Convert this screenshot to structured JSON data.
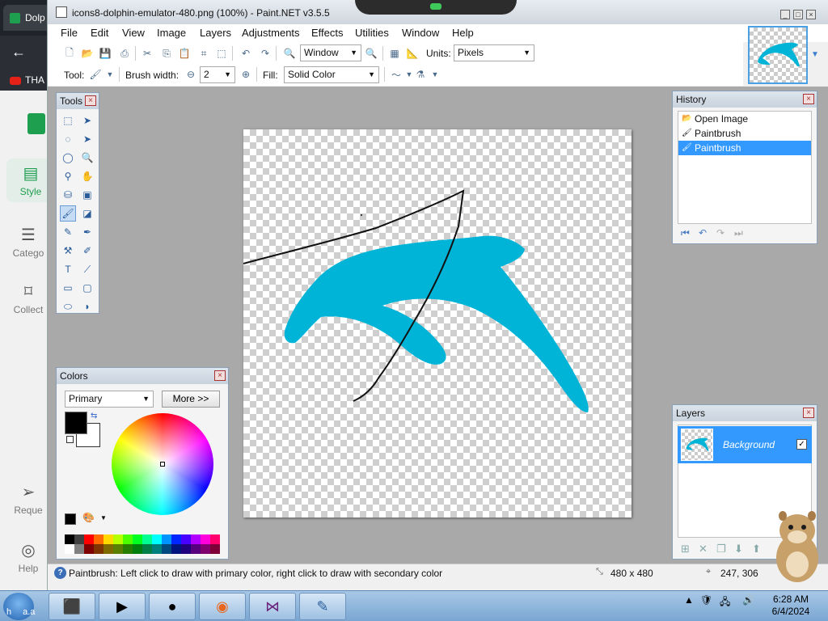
{
  "background_browser": {
    "tab_label": "Dolp",
    "bookmark_label": "THA",
    "sidebar": [
      {
        "label": "Style",
        "icon": "layers-icon",
        "active": true
      },
      {
        "label": "Catego",
        "icon": "list-icon",
        "active": false
      },
      {
        "label": "Collect",
        "icon": "bookmark-icon",
        "active": false
      },
      {
        "label": "Reque",
        "icon": "send-icon",
        "active": false
      },
      {
        "label": "Help",
        "icon": "lifebuoy-icon",
        "active": false
      }
    ]
  },
  "window": {
    "title": "icons8-dolphin-emulator-480.png (100%) - Paint.NET v3.5.5"
  },
  "menu": [
    "File",
    "Edit",
    "View",
    "Image",
    "Layers",
    "Adjustments",
    "Effects",
    "Utilities",
    "Window",
    "Help"
  ],
  "toolbar": {
    "zoom_value": "Window",
    "units_label": "Units:",
    "units_value": "Pixels",
    "tool_label": "Tool:",
    "brush_width_label": "Brush width:",
    "brush_width_value": "2",
    "fill_label": "Fill:",
    "fill_value": "Solid Color"
  },
  "panels": {
    "tools_title": "Tools",
    "history_title": "History",
    "history_items": [
      {
        "label": "Open Image",
        "icon": "folder-icon",
        "selected": false
      },
      {
        "label": "Paintbrush",
        "icon": "paintbrush-icon",
        "selected": false
      },
      {
        "label": "Paintbrush",
        "icon": "paintbrush-icon",
        "selected": true
      }
    ],
    "colors_title": "Colors",
    "colors_mode": "Primary",
    "colors_more": "More >>",
    "layers_title": "Layers",
    "layer_name": "Background"
  },
  "status": {
    "text": "Paintbrush: Left click to draw with primary color, right click to draw with secondary color",
    "image_size": "480 x 480",
    "cursor_pos": "247, 306"
  },
  "taskbar": {
    "start_label": "h",
    "start_label_suffix": "a.a",
    "time": "6:28 AM",
    "date": "6/4/2024"
  },
  "colors": {
    "dolphin": "#00b4d8",
    "selection": "#3399ff",
    "primary": "#000000",
    "secondary": "#ffffff"
  }
}
